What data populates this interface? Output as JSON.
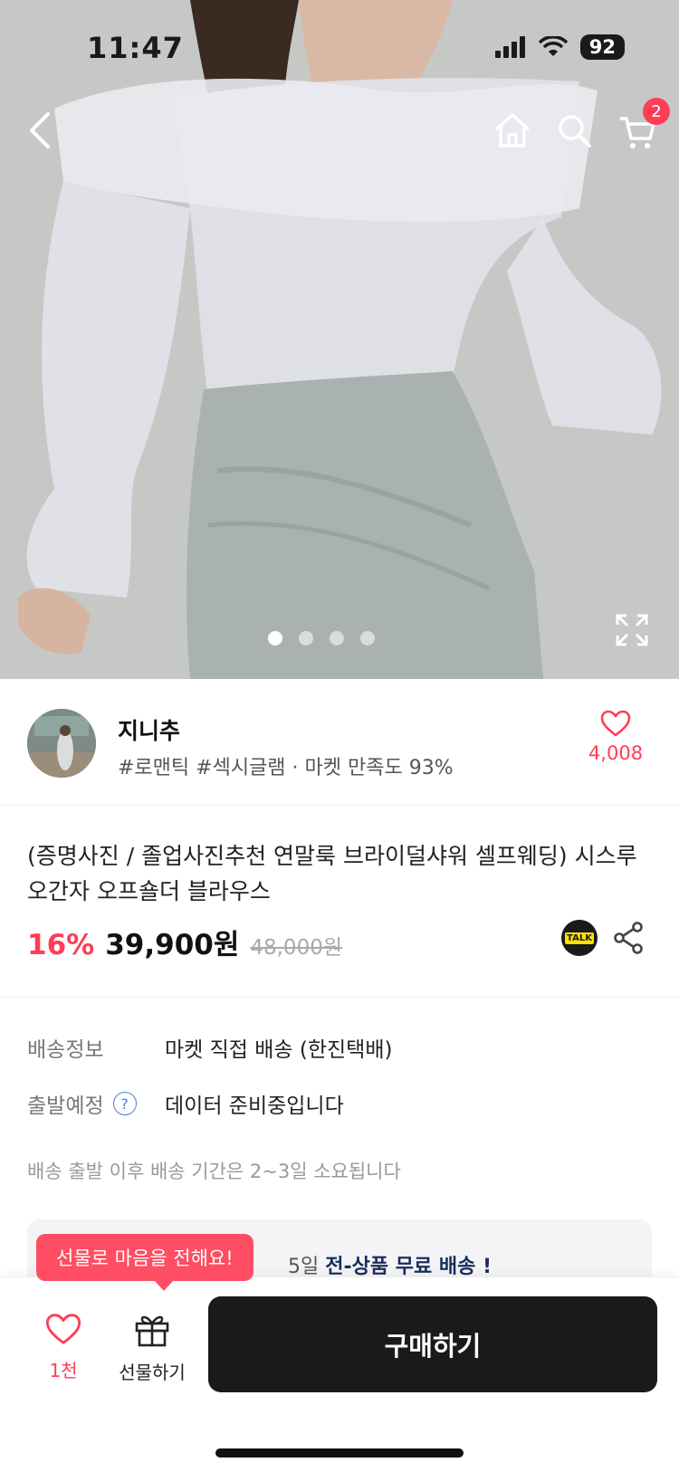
{
  "status_bar": {
    "time": "11:47",
    "battery": "92"
  },
  "header": {
    "cart_count": "2"
  },
  "gallery": {
    "total_images": 4,
    "active_index": 0
  },
  "shop": {
    "name": "지니추",
    "tags": "#로맨틱 #섹시글램 · 마켓 만족도 93%",
    "like_count": "4,008"
  },
  "product": {
    "title": "(증명사진 / 졸업사진추천 연말룩 브라이덜샤워 셀프웨딩) 시스루 오간자 오프숄더 블라우스",
    "discount": "16%",
    "price": "39,900원",
    "original_price": "48,000원",
    "talk_label": "TALK"
  },
  "shipping": {
    "info_label": "배송정보",
    "info_value": "마켓 직접 배송 (한진택배)",
    "departure_label": "출발예정",
    "departure_value": "데이터 준비중입니다",
    "note": "배송 출발 이후 배송 기간은 2~3일 소요됩니다",
    "help_icon": "?"
  },
  "promo": {
    "partial_text": "5일 ",
    "bold_text": "전-상품 무료 배송 !"
  },
  "bottom_bar": {
    "tooltip": "선물로 마음을 전해요!",
    "like_label": "1천",
    "gift_label": "선물하기",
    "buy_label": "구매하기"
  },
  "colors": {
    "accent": "#ff3d56",
    "buy_button": "#1a1a1a",
    "promo_bg": "#f4f4f6"
  }
}
